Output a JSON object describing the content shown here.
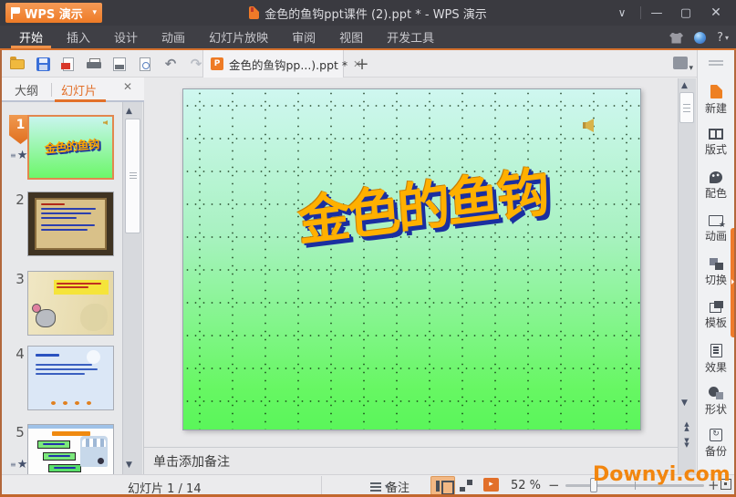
{
  "titlebar": {
    "app_name": "WPS 演示",
    "doc_title": "金色的鱼钩ppt课件 (2).ppt * - WPS 演示"
  },
  "glyphs": {
    "caret_down": "▾",
    "chevron_down": "∨",
    "minimize": "—",
    "maximize": "▢",
    "close": "✕",
    "undo": "↶",
    "redo": "↷",
    "plus": "+",
    "minus": "−",
    "scroll_up": "▲",
    "scroll_down": "▼",
    "star": "★",
    "star_lines": "≡",
    "help": "?",
    "play": "▸",
    "p_logo": "P"
  },
  "ribbon": {
    "tabs": [
      {
        "label": "开始",
        "active": true
      },
      {
        "label": "插入"
      },
      {
        "label": "设计"
      },
      {
        "label": "动画"
      },
      {
        "label": "幻灯片放映"
      },
      {
        "label": "审阅"
      },
      {
        "label": "视图"
      },
      {
        "label": "开发工具"
      }
    ]
  },
  "toolbar": {
    "doc_tab": {
      "label": "金色的鱼钩pp...).ppt *"
    }
  },
  "left_panel": {
    "tabs": {
      "outline": "大纲",
      "slides": "幻灯片"
    },
    "slides": [
      {
        "number": "1",
        "selected": true,
        "starred": true
      },
      {
        "number": "2"
      },
      {
        "number": "3"
      },
      {
        "number": "4"
      },
      {
        "number": "5",
        "starred": true
      }
    ]
  },
  "slide": {
    "wordart": "金色的鱼钩"
  },
  "notes": {
    "placeholder": "单击添加备注"
  },
  "sidebar": {
    "items": [
      {
        "label": "新建"
      },
      {
        "label": "版式"
      },
      {
        "label": "配色"
      },
      {
        "label": "动画"
      },
      {
        "label": "切换"
      },
      {
        "label": "模板"
      },
      {
        "label": "效果"
      },
      {
        "label": "形状"
      },
      {
        "label": "备份"
      }
    ]
  },
  "statusbar": {
    "slide_counter": "幻灯片 1 / 14",
    "notes_label": "备注",
    "zoom_level": "52 %"
  },
  "watermark": "Downyi.com",
  "colors": {
    "accent_orange": "#ED7B2B",
    "titlebar_bg": "#3A3A40",
    "ribbon_bg": "#3F3F45",
    "slide_green": "#5AF65A",
    "slide_cyan": "#CFF7F0",
    "wordart_gold": "#FFB000",
    "wordart_navy": "#1B2FA0",
    "watermark_orange": "#F2860F"
  }
}
